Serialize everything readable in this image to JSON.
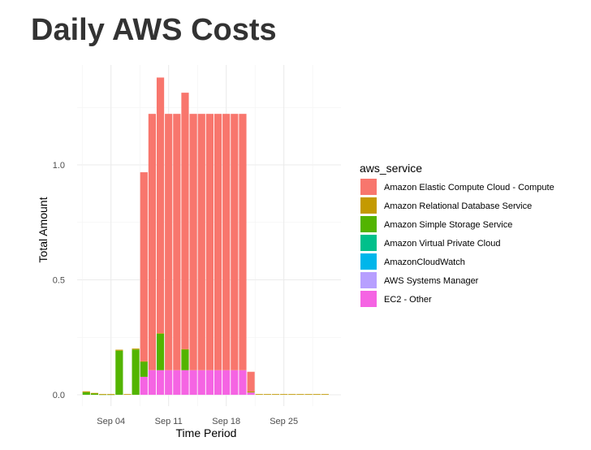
{
  "page_title": "Daily AWS Costs",
  "chart_data": {
    "type": "bar",
    "stacked": true,
    "title": "Daily AWS Costs",
    "xlabel": "Time Period",
    "ylabel": "Total Amount",
    "ylim": [
      0,
      1.45
    ],
    "yticks": [
      0.0,
      0.5,
      1.0
    ],
    "ytick_labels": [
      "0.0",
      "0.5",
      "1.0"
    ],
    "xtick_labels": [
      "Sep 04",
      "Sep 11",
      "Sep 18",
      "Sep 25"
    ],
    "xtick_days": [
      4,
      11,
      18,
      25
    ],
    "legend_title": "aws_service",
    "legend_position": "right",
    "days": [
      1,
      2,
      3,
      4,
      5,
      6,
      7,
      8,
      9,
      10,
      11,
      12,
      13,
      14,
      15,
      16,
      17,
      18,
      19,
      20,
      21,
      22,
      23,
      24,
      25,
      26,
      27,
      28,
      29,
      30
    ],
    "series": [
      {
        "name": "EC2 - Other",
        "color": "#F564E3",
        "values": [
          0,
          0,
          0,
          0,
          0,
          0,
          0,
          0.078,
          0.107,
          0.107,
          0.107,
          0.107,
          0.107,
          0.107,
          0.107,
          0.107,
          0.107,
          0.107,
          0.107,
          0.107,
          0.01,
          0,
          0,
          0,
          0,
          0,
          0,
          0,
          0,
          0
        ]
      },
      {
        "name": "AWS Systems Manager",
        "color": "#B79FFF",
        "values": [
          0,
          0,
          0,
          0,
          0,
          0,
          0,
          0,
          0,
          0,
          0,
          0,
          0,
          0,
          0,
          0,
          0,
          0,
          0,
          0,
          0,
          0,
          0,
          0,
          0,
          0,
          0,
          0,
          0,
          0
        ]
      },
      {
        "name": "AmazonCloudWatch",
        "color": "#00B6EB",
        "values": [
          0,
          0,
          0,
          0,
          0,
          0,
          0,
          0,
          0,
          0,
          0,
          0,
          0,
          0,
          0,
          0,
          0,
          0,
          0,
          0,
          0,
          0,
          0,
          0,
          0,
          0,
          0,
          0,
          0,
          0
        ]
      },
      {
        "name": "Amazon Virtual Private Cloud",
        "color": "#00C08B",
        "values": [
          0,
          0,
          0,
          0,
          0,
          0,
          0,
          0,
          0,
          0,
          0,
          0,
          0,
          0,
          0,
          0,
          0,
          0,
          0,
          0,
          0,
          0,
          0,
          0,
          0,
          0,
          0,
          0,
          0,
          0
        ]
      },
      {
        "name": "Amazon Simple Storage Service",
        "color": "#53B400",
        "values": [
          0.011,
          0.006,
          0.002,
          0.002,
          0.192,
          0,
          0.197,
          0.067,
          0,
          0.158,
          0,
          0,
          0.091,
          0,
          0,
          0,
          0,
          0,
          0,
          0,
          0.003,
          0,
          0,
          0,
          0,
          0,
          0,
          0,
          0,
          0
        ]
      },
      {
        "name": "Amazon Relational Database Service",
        "color": "#C49A00",
        "values": [
          0.004,
          0.002,
          0.001,
          0.001,
          0.004,
          0.003,
          0.004,
          0.001,
          0,
          0.003,
          0,
          0,
          0.001,
          0,
          0,
          0,
          0,
          0,
          0,
          0,
          0.001,
          0.003,
          0.003,
          0.003,
          0.003,
          0.003,
          0.003,
          0.003,
          0.003,
          0.003
        ]
      },
      {
        "name": "Amazon Elastic Compute Cloud - Compute",
        "color": "#F8766D",
        "values": [
          0,
          0,
          0,
          0,
          0,
          0,
          0,
          0.822,
          1.115,
          1.112,
          1.115,
          1.115,
          1.115,
          1.115,
          1.115,
          1.115,
          1.115,
          1.115,
          1.115,
          1.115,
          0.086,
          0,
          0,
          0,
          0,
          0,
          0,
          0,
          0,
          0
        ]
      }
    ],
    "legend_order": [
      "Amazon Elastic Compute Cloud - Compute",
      "Amazon Relational Database Service",
      "Amazon Simple Storage Service",
      "Amazon Virtual Private Cloud",
      "AmazonCloudWatch",
      "AWS Systems Manager",
      "EC2 - Other"
    ]
  }
}
